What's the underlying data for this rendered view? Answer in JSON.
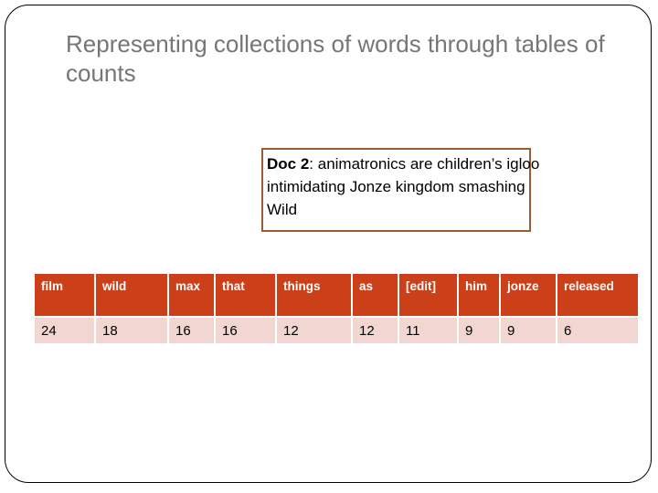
{
  "slide": {
    "title": "Representing collections of words through tables of counts",
    "accent_color": "#CB4018",
    "title_color": "#767676",
    "box_border_color": "#9C5B30",
    "row_color": "#F2D6D2"
  },
  "doc_box": {
    "label": "Doc 2",
    "separator": ": ",
    "body": "animatronics are children’s igloo intimidating Jonze kingdom smashing Wild"
  },
  "table": {
    "headers": [
      "film",
      "wild",
      "max",
      "that",
      "things",
      "as",
      "[edit]",
      "him",
      "jonze",
      "released"
    ],
    "rows": [
      [
        "24",
        "18",
        "16",
        "16",
        "12",
        "12",
        "11",
        "9",
        "9",
        "6"
      ]
    ]
  }
}
